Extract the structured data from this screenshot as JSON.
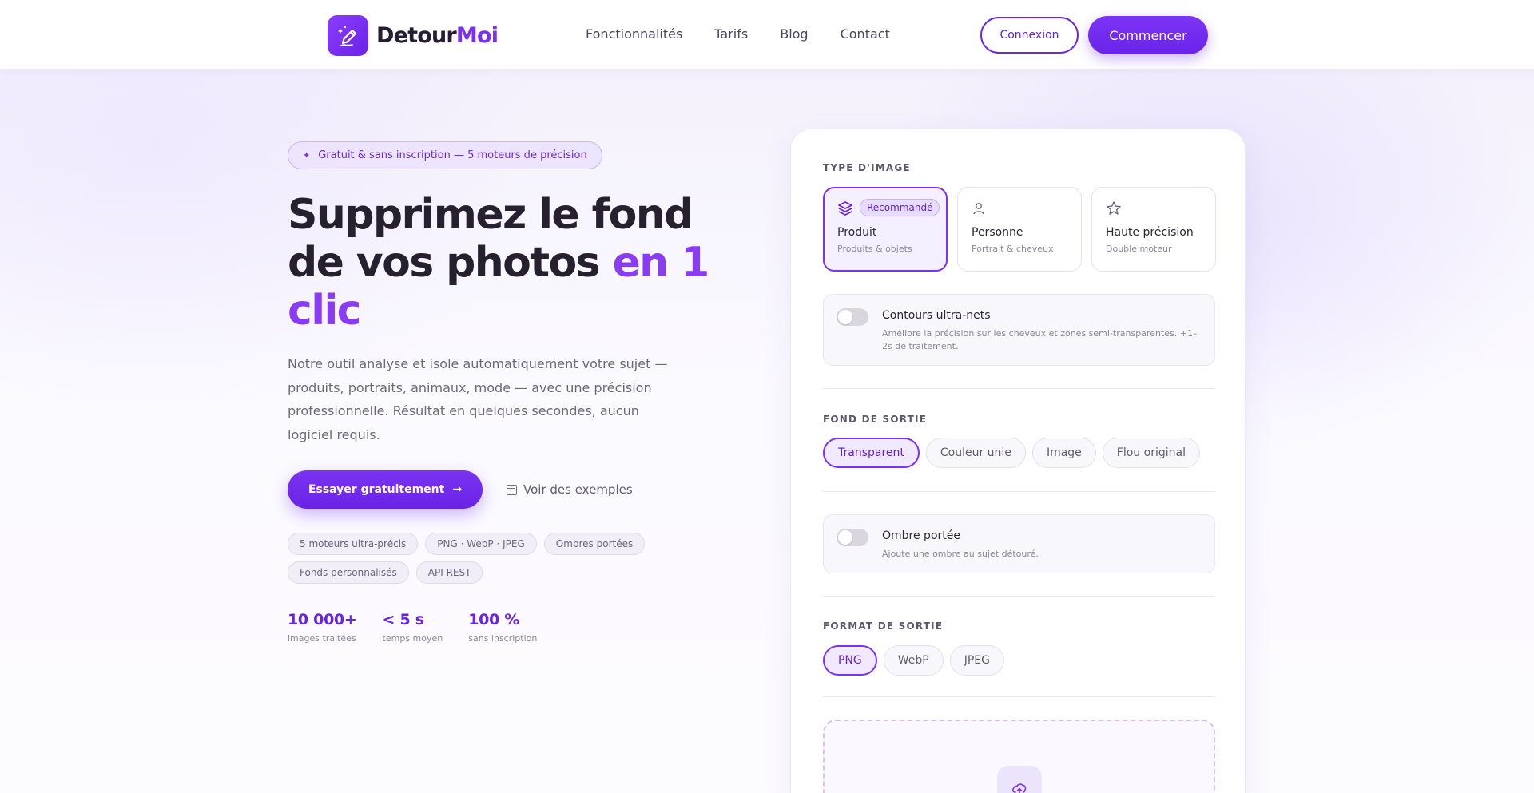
{
  "brand": {
    "part1": "Detour",
    "part2": "Moi"
  },
  "nav": {
    "items": [
      "Fonctionnalités",
      "Tarifs",
      "Blog",
      "Contact"
    ],
    "login_label": "Connexion",
    "start_label": "Commencer"
  },
  "hero": {
    "badge": "Gratuit & sans inscription — 5 moteurs de précision",
    "title_line1": "Supprimez le fond",
    "title_line2_plain": "de vos photos ",
    "title_line2_accent": "en 1 clic",
    "lead": "Notre outil analyse et isole automatiquement votre sujet — produits, portraits, animaux, mode — avec une précision professionnelle. Résultat en quelques secondes, aucun logiciel requis.",
    "cta_label": "Essayer gratuitement",
    "examples_label": "Voir des exemples",
    "chips": [
      "5 moteurs ultra-précis",
      "PNG · WebP · JPEG",
      "Ombres portées",
      "Fonds personnalisés",
      "API REST"
    ],
    "stats": [
      {
        "value": "10 000+",
        "label": "images traitées"
      },
      {
        "value": "< 5 s",
        "label": "temps moyen"
      },
      {
        "value": "100 %",
        "label": "sans inscription"
      }
    ]
  },
  "panel": {
    "image_type_label": "TYPE D'IMAGE",
    "types": [
      {
        "title": "Produit",
        "subtitle": "Produits & objets",
        "badge": "Recommandé",
        "icon": "layers-icon",
        "active": true
      },
      {
        "title": "Personne",
        "subtitle": "Portrait & cheveux",
        "icon": "user-icon",
        "active": false
      },
      {
        "title": "Haute précision",
        "subtitle": "Double moteur",
        "icon": "star-icon",
        "active": false
      }
    ],
    "sharp_edges": {
      "title": "Contours ultra-nets",
      "description": "Améliore la précision sur les cheveux et zones semi-transparentes. +1–2s de traitement.",
      "enabled": false
    },
    "background_label": "FOND DE SORTIE",
    "backgrounds": [
      "Transparent",
      "Couleur unie",
      "Image",
      "Flou original"
    ],
    "background_selected": "Transparent",
    "shadow": {
      "title": "Ombre portée",
      "description": "Ajoute une ombre au sujet détouré.",
      "enabled": false
    },
    "format_label": "FORMAT DE SORTIE",
    "formats": [
      "PNG",
      "WebP",
      "JPEG"
    ],
    "format_selected": "PNG",
    "upload_icon": "cloud-upload-icon"
  },
  "colors": {
    "accent": "#7b33f2",
    "accent_dark": "#6a23e6",
    "text_dark": "#27212f",
    "muted": "#6c6879"
  }
}
